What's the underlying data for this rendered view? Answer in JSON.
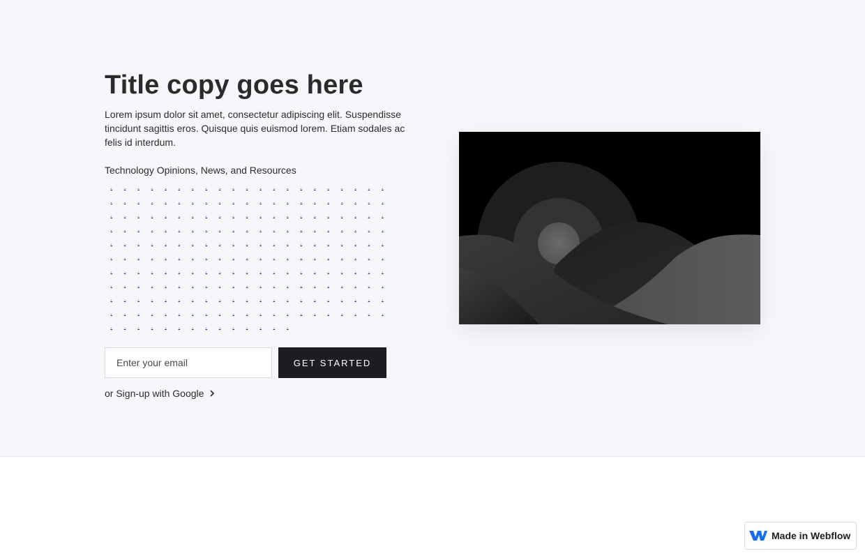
{
  "hero": {
    "title": "Title copy goes here",
    "lead": "Lorem ipsum dolor sit amet, consectetur adipiscing elit. Suspendisse tincidunt sagittis eros. Quisque quis euismod lorem. Etiam sodales ac felis id interdum.",
    "tagline": "Technology Opinions, News, and Resources",
    "link_glyph": ".",
    "link_count": 224
  },
  "form": {
    "email_placeholder": "Enter your email",
    "cta_label": "GET STARTED",
    "google_link": "or Sign-up with Google"
  },
  "badge": {
    "label": "Made in Webflow"
  },
  "icons": {
    "chevron": "chevron-right-icon",
    "webflow": "webflow-logo-icon",
    "image": "landscape-placeholder-image"
  },
  "colors": {
    "hero_bg": "#f5f7fa",
    "cta_bg": "#1b1d22",
    "webflow_blue": "#146ef5"
  }
}
